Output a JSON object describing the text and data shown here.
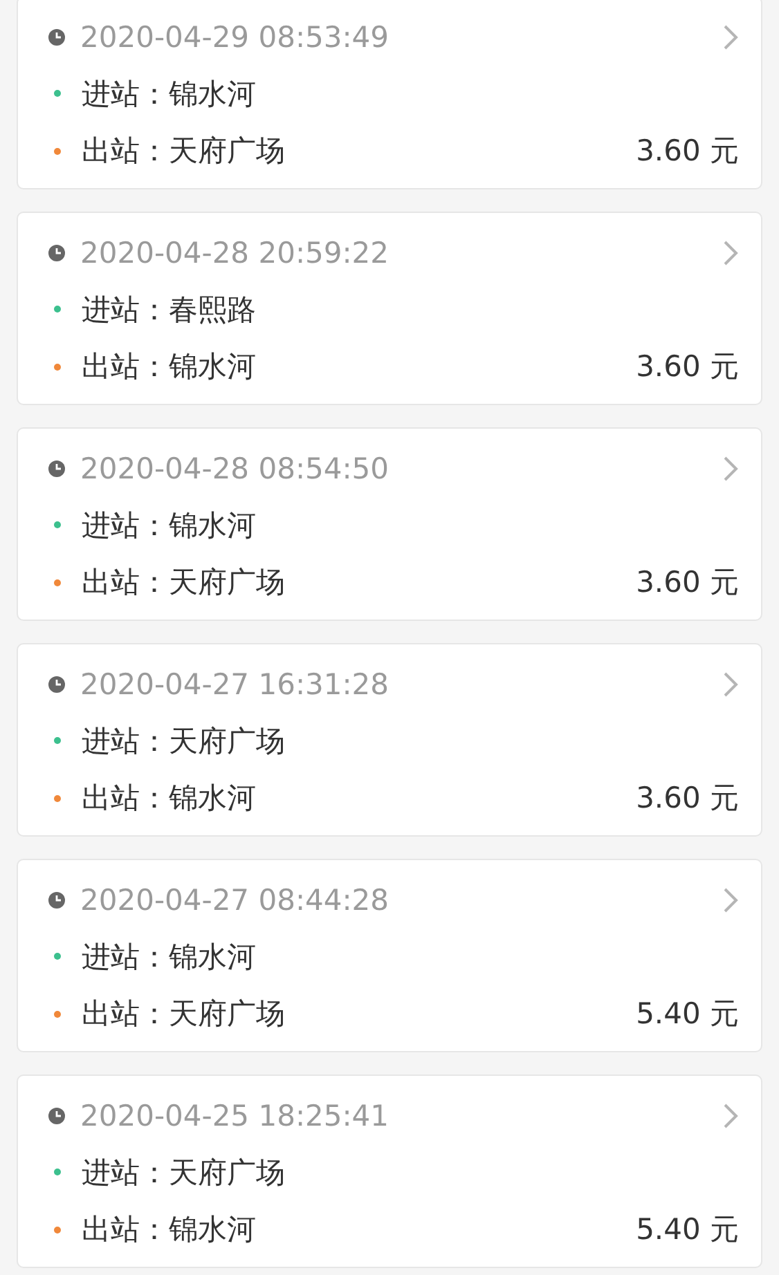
{
  "records": [
    {
      "time": "2020-04-29 08:53:49",
      "stops": [
        {
          "text": "进站：锦水河",
          "color": "#3cc08e"
        },
        {
          "text": "出站：天府广场",
          "color": "#f0883a"
        }
      ],
      "fare": "3.60 元"
    },
    {
      "time": "2020-04-28 20:59:22",
      "stops": [
        {
          "text": "进站：春熙路",
          "color": "#3cc08e"
        },
        {
          "text": "出站：锦水河",
          "color": "#f0883a"
        }
      ],
      "fare": "3.60 元"
    },
    {
      "time": "2020-04-28 08:54:50",
      "stops": [
        {
          "text": "进站：锦水河",
          "color": "#3cc08e"
        },
        {
          "text": "出站：天府广场",
          "color": "#f0883a"
        }
      ],
      "fare": "3.60 元"
    },
    {
      "time": "2020-04-27 16:31:28",
      "stops": [
        {
          "text": "进站：天府广场",
          "color": "#3cc08e"
        },
        {
          "text": "出站：锦水河",
          "color": "#f0883a"
        }
      ],
      "fare": "3.60 元"
    },
    {
      "time": "2020-04-27 08:44:28",
      "stops": [
        {
          "text": "进站：锦水河",
          "color": "#3cc08e"
        },
        {
          "text": "出站：天府广场",
          "color": "#f0883a"
        }
      ],
      "fare": "5.40 元"
    },
    {
      "time": "2020-04-25 18:25:41",
      "stops": [
        {
          "text": "进站：天府广场",
          "color": "#3cc08e"
        },
        {
          "text": "出站：锦水河",
          "color": "#f0883a"
        }
      ],
      "fare": "5.40 元"
    }
  ]
}
